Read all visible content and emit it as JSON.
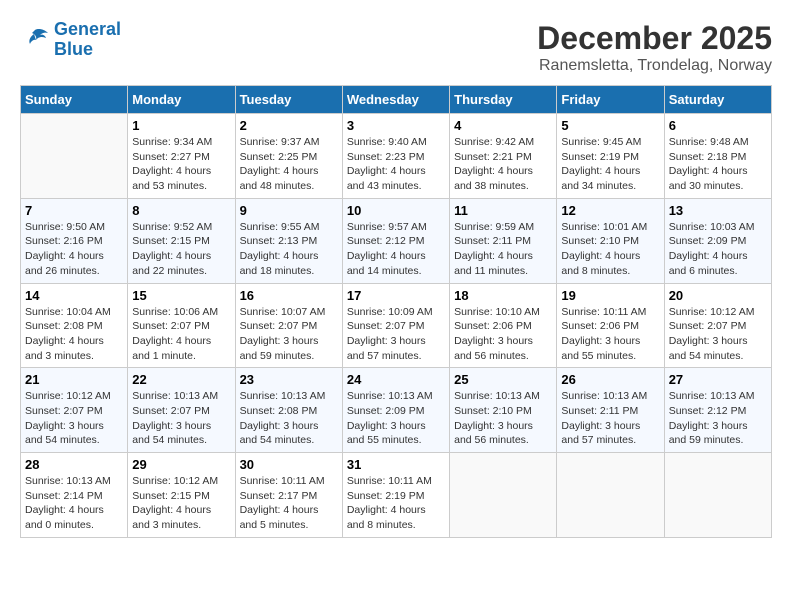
{
  "logo": {
    "line1": "General",
    "line2": "Blue"
  },
  "title": "December 2025",
  "location": "Ranemsletta, Trondelag, Norway",
  "days_of_week": [
    "Sunday",
    "Monday",
    "Tuesday",
    "Wednesday",
    "Thursday",
    "Friday",
    "Saturday"
  ],
  "weeks": [
    [
      {
        "day": "",
        "info": ""
      },
      {
        "day": "1",
        "info": "Sunrise: 9:34 AM\nSunset: 2:27 PM\nDaylight: 4 hours\nand 53 minutes."
      },
      {
        "day": "2",
        "info": "Sunrise: 9:37 AM\nSunset: 2:25 PM\nDaylight: 4 hours\nand 48 minutes."
      },
      {
        "day": "3",
        "info": "Sunrise: 9:40 AM\nSunset: 2:23 PM\nDaylight: 4 hours\nand 43 minutes."
      },
      {
        "day": "4",
        "info": "Sunrise: 9:42 AM\nSunset: 2:21 PM\nDaylight: 4 hours\nand 38 minutes."
      },
      {
        "day": "5",
        "info": "Sunrise: 9:45 AM\nSunset: 2:19 PM\nDaylight: 4 hours\nand 34 minutes."
      },
      {
        "day": "6",
        "info": "Sunrise: 9:48 AM\nSunset: 2:18 PM\nDaylight: 4 hours\nand 30 minutes."
      }
    ],
    [
      {
        "day": "7",
        "info": "Sunrise: 9:50 AM\nSunset: 2:16 PM\nDaylight: 4 hours\nand 26 minutes."
      },
      {
        "day": "8",
        "info": "Sunrise: 9:52 AM\nSunset: 2:15 PM\nDaylight: 4 hours\nand 22 minutes."
      },
      {
        "day": "9",
        "info": "Sunrise: 9:55 AM\nSunset: 2:13 PM\nDaylight: 4 hours\nand 18 minutes."
      },
      {
        "day": "10",
        "info": "Sunrise: 9:57 AM\nSunset: 2:12 PM\nDaylight: 4 hours\nand 14 minutes."
      },
      {
        "day": "11",
        "info": "Sunrise: 9:59 AM\nSunset: 2:11 PM\nDaylight: 4 hours\nand 11 minutes."
      },
      {
        "day": "12",
        "info": "Sunrise: 10:01 AM\nSunset: 2:10 PM\nDaylight: 4 hours\nand 8 minutes."
      },
      {
        "day": "13",
        "info": "Sunrise: 10:03 AM\nSunset: 2:09 PM\nDaylight: 4 hours\nand 6 minutes."
      }
    ],
    [
      {
        "day": "14",
        "info": "Sunrise: 10:04 AM\nSunset: 2:08 PM\nDaylight: 4 hours\nand 3 minutes."
      },
      {
        "day": "15",
        "info": "Sunrise: 10:06 AM\nSunset: 2:07 PM\nDaylight: 4 hours\nand 1 minute."
      },
      {
        "day": "16",
        "info": "Sunrise: 10:07 AM\nSunset: 2:07 PM\nDaylight: 3 hours\nand 59 minutes."
      },
      {
        "day": "17",
        "info": "Sunrise: 10:09 AM\nSunset: 2:07 PM\nDaylight: 3 hours\nand 57 minutes."
      },
      {
        "day": "18",
        "info": "Sunrise: 10:10 AM\nSunset: 2:06 PM\nDaylight: 3 hours\nand 56 minutes."
      },
      {
        "day": "19",
        "info": "Sunrise: 10:11 AM\nSunset: 2:06 PM\nDaylight: 3 hours\nand 55 minutes."
      },
      {
        "day": "20",
        "info": "Sunrise: 10:12 AM\nSunset: 2:07 PM\nDaylight: 3 hours\nand 54 minutes."
      }
    ],
    [
      {
        "day": "21",
        "info": "Sunrise: 10:12 AM\nSunset: 2:07 PM\nDaylight: 3 hours\nand 54 minutes."
      },
      {
        "day": "22",
        "info": "Sunrise: 10:13 AM\nSunset: 2:07 PM\nDaylight: 3 hours\nand 54 minutes."
      },
      {
        "day": "23",
        "info": "Sunrise: 10:13 AM\nSunset: 2:08 PM\nDaylight: 3 hours\nand 54 minutes."
      },
      {
        "day": "24",
        "info": "Sunrise: 10:13 AM\nSunset: 2:09 PM\nDaylight: 3 hours\nand 55 minutes."
      },
      {
        "day": "25",
        "info": "Sunrise: 10:13 AM\nSunset: 2:10 PM\nDaylight: 3 hours\nand 56 minutes."
      },
      {
        "day": "26",
        "info": "Sunrise: 10:13 AM\nSunset: 2:11 PM\nDaylight: 3 hours\nand 57 minutes."
      },
      {
        "day": "27",
        "info": "Sunrise: 10:13 AM\nSunset: 2:12 PM\nDaylight: 3 hours\nand 59 minutes."
      }
    ],
    [
      {
        "day": "28",
        "info": "Sunrise: 10:13 AM\nSunset: 2:14 PM\nDaylight: 4 hours\nand 0 minutes."
      },
      {
        "day": "29",
        "info": "Sunrise: 10:12 AM\nSunset: 2:15 PM\nDaylight: 4 hours\nand 3 minutes."
      },
      {
        "day": "30",
        "info": "Sunrise: 10:11 AM\nSunset: 2:17 PM\nDaylight: 4 hours\nand 5 minutes."
      },
      {
        "day": "31",
        "info": "Sunrise: 10:11 AM\nSunset: 2:19 PM\nDaylight: 4 hours\nand 8 minutes."
      },
      {
        "day": "",
        "info": ""
      },
      {
        "day": "",
        "info": ""
      },
      {
        "day": "",
        "info": ""
      }
    ]
  ]
}
